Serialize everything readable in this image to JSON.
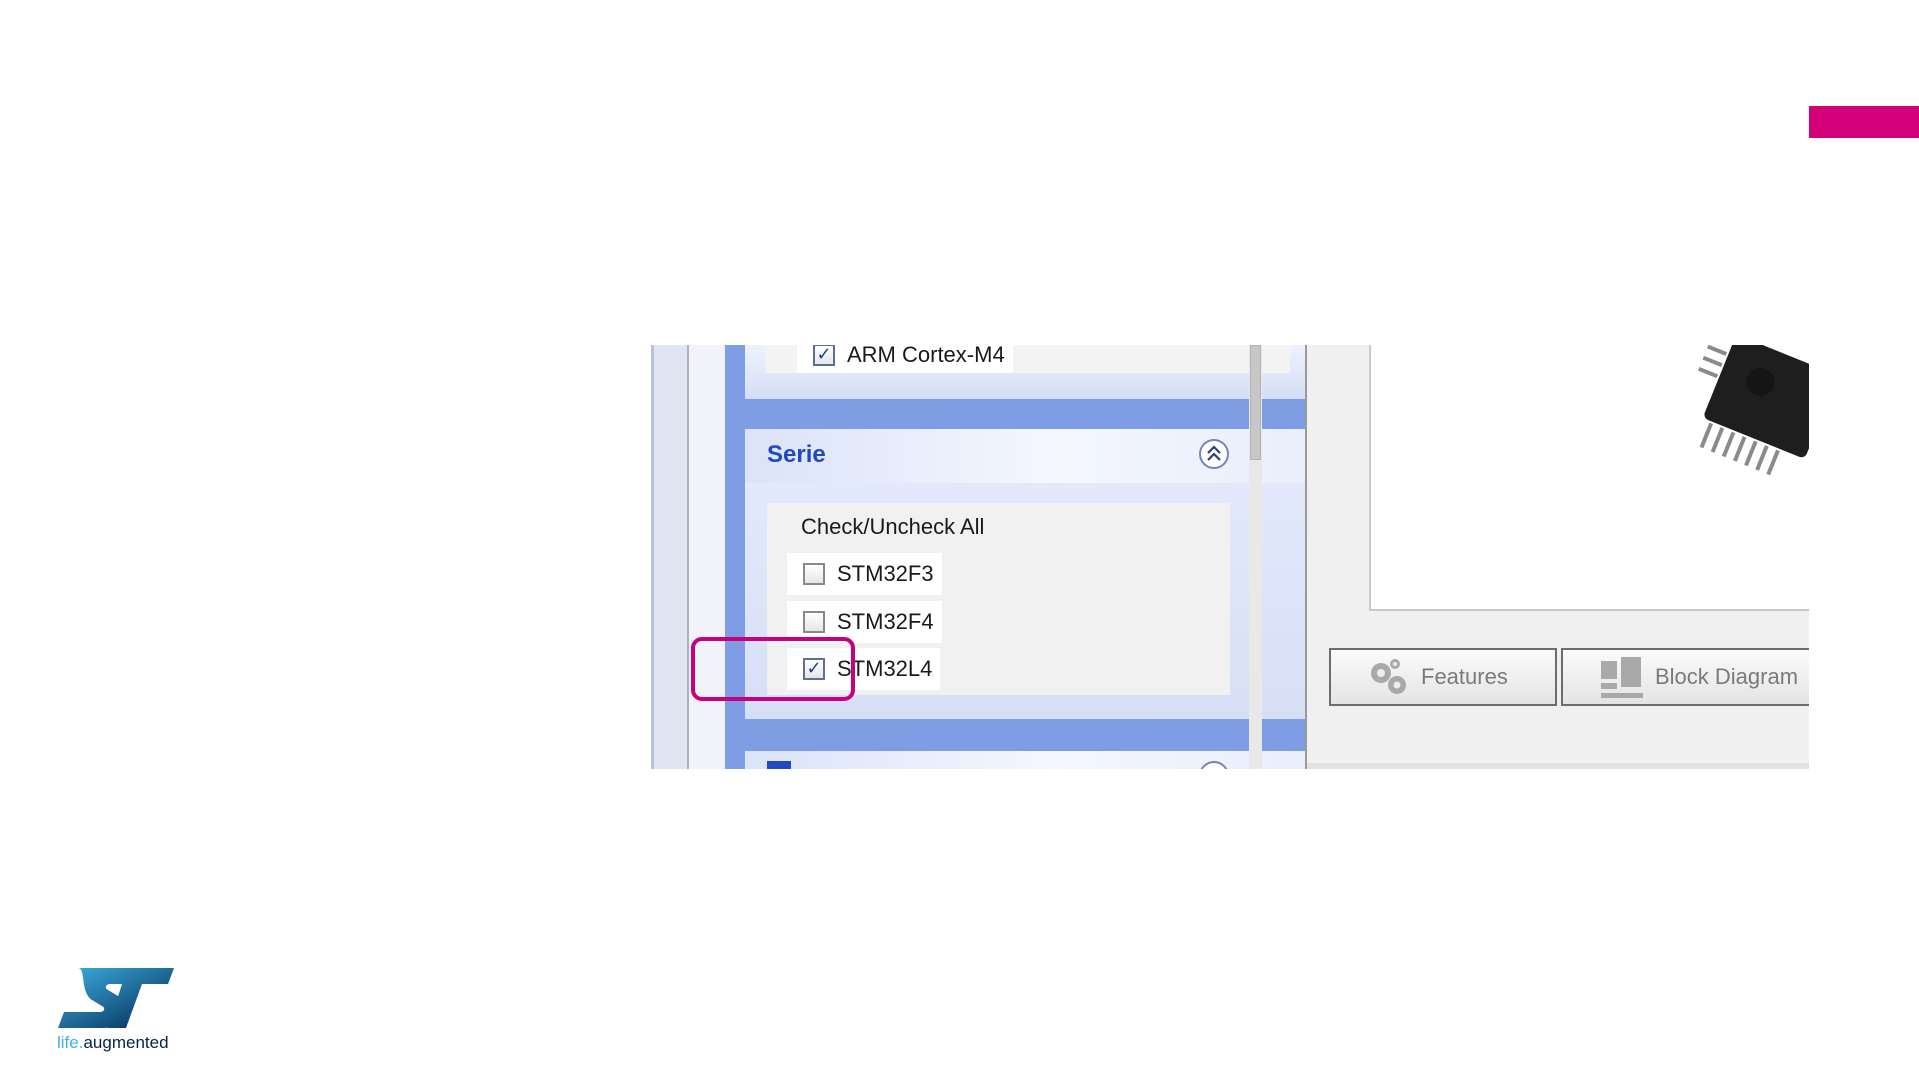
{
  "accent_color": "#d4007a",
  "highlight_color": "#c6007e",
  "core": {
    "items": [
      {
        "label": "ARM Cortex-M4",
        "checked": true
      }
    ]
  },
  "serie": {
    "title": "Serie",
    "check_all_label": "Check/Uncheck All",
    "items": [
      {
        "label": "STM32F3",
        "checked": false
      },
      {
        "label": "STM32F4",
        "checked": false
      },
      {
        "label": "STM32L4",
        "checked": true
      }
    ],
    "highlighted_item": "STM32L4"
  },
  "buttons": {
    "features": "Features",
    "block_diagram": "Block Diagram"
  },
  "logo": {
    "prefix": "life.",
    "suffix": "augmented"
  }
}
